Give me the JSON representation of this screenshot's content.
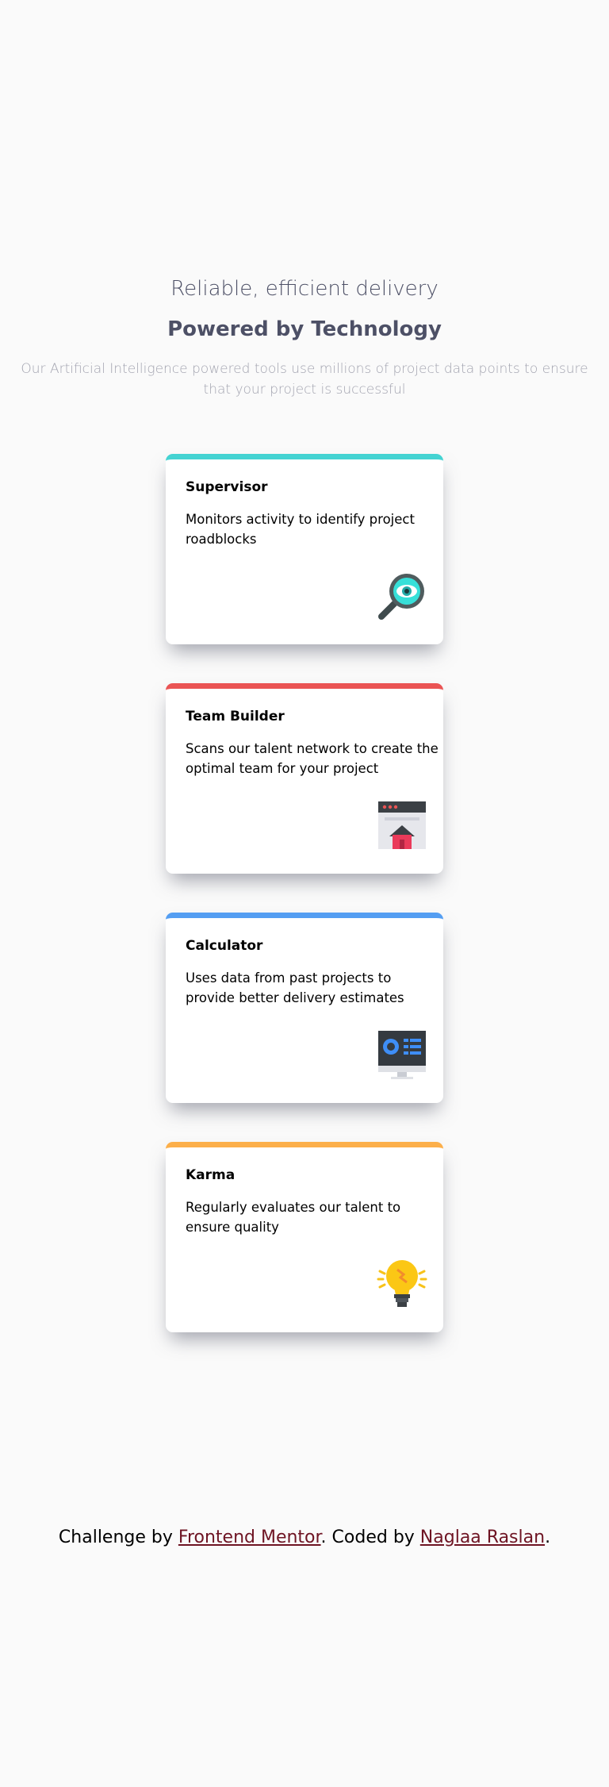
{
  "header": {
    "subtitle": "Reliable, efficient delivery",
    "title": "Powered by Technology",
    "intro": "Our Artificial Intelligence powered tools use millions of project data points to ensure that your project is successful"
  },
  "cards": [
    {
      "title": "Supervisor",
      "text": "Monitors activity to identify project roadblocks",
      "icon": "supervisor-magnifier-eye-icon",
      "accent": "#44d3d2"
    },
    {
      "title": "Team Builder",
      "text": "Scans our talent network to create the optimal team for your project",
      "icon": "team-builder-browser-house-icon",
      "accent": "#ea5454"
    },
    {
      "title": "Calculator",
      "text": "Uses data from past projects to provide better delivery estimates",
      "icon": "calculator-monitor-icon",
      "accent": "#549ef2"
    },
    {
      "title": "Karma",
      "text": "Regularly evaluates our talent to ensure quality",
      "icon": "karma-lightbulb-icon",
      "accent": "#fcaf4a"
    }
  ],
  "attribution": {
    "prefix": "Challenge by ",
    "link1_text": "Frontend Mentor",
    "middle": ". Coded by ",
    "link2_text": "Naglaa Raslan",
    "suffix": "."
  },
  "colors": {
    "background": "#fafafa",
    "heading": "#4d5066",
    "muted": "#a3a4b0",
    "link": "#6e1423"
  }
}
